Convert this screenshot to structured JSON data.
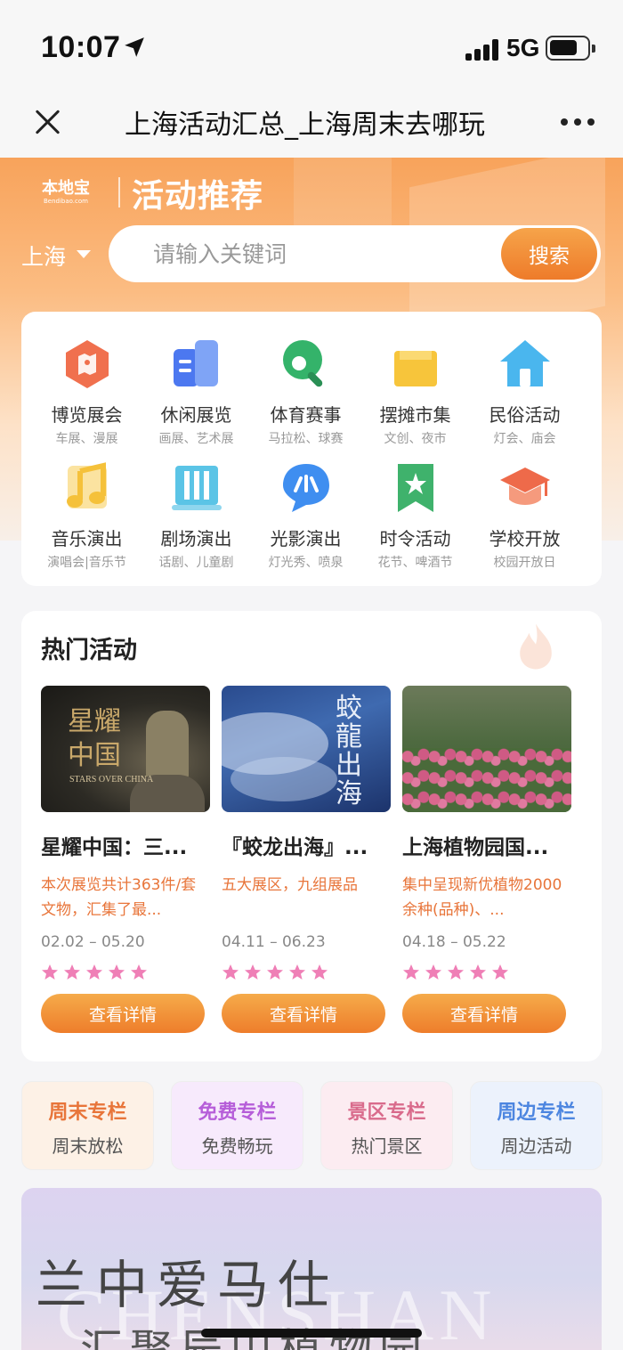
{
  "status": {
    "time": "10:07",
    "network": "5G"
  },
  "nav": {
    "title": "上海活动汇总_上海周末去哪玩"
  },
  "banner": {
    "logo_text": "本地宝",
    "logo_sub": "Bendibao.com",
    "title": "活动推荐",
    "city": "上海",
    "search_placeholder": "请输入关键词",
    "search_button": "搜索"
  },
  "categories": [
    {
      "name": "博览展会",
      "sub": "车展、漫展",
      "icon": "map-expo-icon",
      "color": "#f0704e"
    },
    {
      "name": "休闲展览",
      "sub": "画展、艺术展",
      "icon": "book-exhibit-icon",
      "color": "#4c78f0"
    },
    {
      "name": "体育赛事",
      "sub": "马拉松、球赛",
      "icon": "ping-pong-icon",
      "color": "#34b36a"
    },
    {
      "name": "摆摊市集",
      "sub": "文创、夜市",
      "icon": "shopping-bag-icon",
      "color": "#f7c53b"
    },
    {
      "name": "民俗活动",
      "sub": "灯会、庙会",
      "icon": "house-icon",
      "color": "#4ab6ee"
    },
    {
      "name": "音乐演出",
      "sub": "演唱会|音乐节",
      "icon": "music-note-icon",
      "color": "#f5c13a"
    },
    {
      "name": "剧场演出",
      "sub": "话剧、儿童剧",
      "icon": "theater-icon",
      "color": "#5bc4e6"
    },
    {
      "name": "光影演出",
      "sub": "灯光秀、喷泉",
      "icon": "light-show-icon",
      "color": "#3f8ef0"
    },
    {
      "name": "时令活动",
      "sub": "花节、啤酒节",
      "icon": "bookmark-star-icon",
      "color": "#3fb26c"
    },
    {
      "name": "学校开放",
      "sub": "校园开放日",
      "icon": "graduation-cap-icon",
      "color": "#ee6a4a"
    }
  ],
  "hot": {
    "title": "热门活动",
    "details_label": "查看详情",
    "rating": 5,
    "items": [
      {
        "title": "星耀中国：三...",
        "desc": "本次展览共计363件/套文物，汇集了最...",
        "date": "02.02 – 05.20",
        "img_caption": "星耀中国",
        "img_caption_en": "STARS OVER CHINA"
      },
      {
        "title": "『蛟龙出海』...",
        "desc": "五大展区，九组展品",
        "date": "04.11 – 06.23",
        "img_caption": "蛟龍出海",
        "img_caption_en": ""
      },
      {
        "title": "上海植物园国...",
        "desc": "集中呈现新优植物2000余种(品种)、...",
        "date": "04.18 – 05.22",
        "img_caption": "",
        "img_caption_en": ""
      }
    ]
  },
  "columns": [
    {
      "title": "周末专栏",
      "sub": "周末放松",
      "color": "#e8753a",
      "bg": "#fdf1e6"
    },
    {
      "title": "免费专栏",
      "sub": "免费畅玩",
      "color": "#b65ed9",
      "bg": "#f7eafc"
    },
    {
      "title": "景区专栏",
      "sub": "热门景区",
      "color": "#d96b8c",
      "bg": "#fcecf1"
    },
    {
      "title": "周边专栏",
      "sub": "周边活动",
      "color": "#4d86e0",
      "bg": "#ecf2fc"
    }
  ],
  "bottom_banner": {
    "title": "兰中爱马仕",
    "en": "CHENSHAN",
    "sub": "汇聚辰山植物园"
  }
}
